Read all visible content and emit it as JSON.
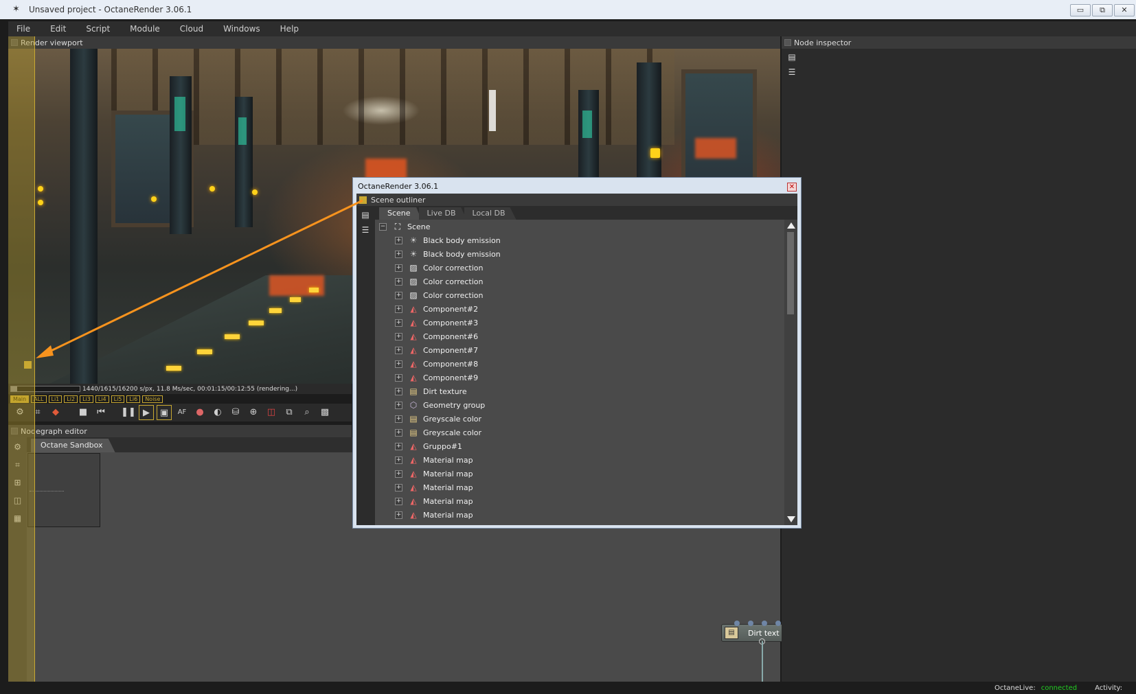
{
  "window": {
    "title": "Unsaved project - OctaneRender 3.06.1",
    "minimize": "▭",
    "restore": "⧉",
    "close": "✕"
  },
  "menu": [
    "File",
    "Edit",
    "Script",
    "Module",
    "Cloud",
    "Windows",
    "Help"
  ],
  "render_viewport": {
    "title": "Render viewport",
    "status": "1440/1615/16200 s/px, 11.8 Ms/sec, 00:01:15/00:12:55 (rendering...)",
    "progress_fraction": 0.09,
    "passes": [
      "Main",
      "ALL",
      "Li1",
      "Li2",
      "Li3",
      "Li4",
      "Li5",
      "Li6",
      "Noise"
    ],
    "active_pass": "Main",
    "toolbar_icons": [
      "clay-mode-icon",
      "region-icon",
      "cube-icon",
      "stop-icon",
      "restart-icon",
      "pause-icon",
      "play-icon",
      "display-icon",
      "af-icon",
      "color-picker-icon",
      "white-balance-icon",
      "material-picker-icon",
      "object-picker-icon",
      "focus-picker-icon",
      "decal-icon",
      "zoom-icon",
      "region-render-icon"
    ]
  },
  "nodegraph": {
    "title": "Nodegraph editor",
    "tab": "Octane Sandbox",
    "node_label": "Dirt text"
  },
  "node_inspector": {
    "title": "Node inspector"
  },
  "outliner_window": {
    "title": "OctaneRender 3.06.1",
    "panel_title": "Scene outliner",
    "tabs": [
      "Scene",
      "Live DB",
      "Local DB"
    ],
    "active_tab": "Scene",
    "root": "Scene",
    "items": [
      {
        "label": "Black body emission",
        "icon": "emission-icon"
      },
      {
        "label": "Black body emission",
        "icon": "emission-icon"
      },
      {
        "label": "Color correction",
        "icon": "color-correction-icon"
      },
      {
        "label": "Color correction",
        "icon": "color-correction-icon"
      },
      {
        "label": "Color correction",
        "icon": "color-correction-icon"
      },
      {
        "label": "Component#2",
        "icon": "material-icon"
      },
      {
        "label": "Component#3",
        "icon": "material-icon"
      },
      {
        "label": "Component#6",
        "icon": "material-icon"
      },
      {
        "label": "Component#7",
        "icon": "material-icon"
      },
      {
        "label": "Component#8",
        "icon": "material-icon"
      },
      {
        "label": "Component#9",
        "icon": "material-icon"
      },
      {
        "label": "Dirt texture",
        "icon": "texture-icon"
      },
      {
        "label": "Geometry group",
        "icon": "geometry-icon"
      },
      {
        "label": "Greyscale color",
        "icon": "texture-icon"
      },
      {
        "label": "Greyscale color",
        "icon": "texture-icon"
      },
      {
        "label": "Gruppo#1",
        "icon": "material-icon"
      },
      {
        "label": "Material map",
        "icon": "material-icon"
      },
      {
        "label": "Material map",
        "icon": "material-icon"
      },
      {
        "label": "Material map",
        "icon": "material-icon"
      },
      {
        "label": "Material map",
        "icon": "material-icon"
      },
      {
        "label": "Material map",
        "icon": "material-icon"
      }
    ]
  },
  "status": {
    "octanelive_label": "OctaneLive:",
    "octanelive_value": "connected",
    "activity_label": "Activity:"
  },
  "colors": {
    "accent_yellow": "#c9a932",
    "callout_orange": "#f7931e",
    "connected_green": "#22cc22"
  }
}
